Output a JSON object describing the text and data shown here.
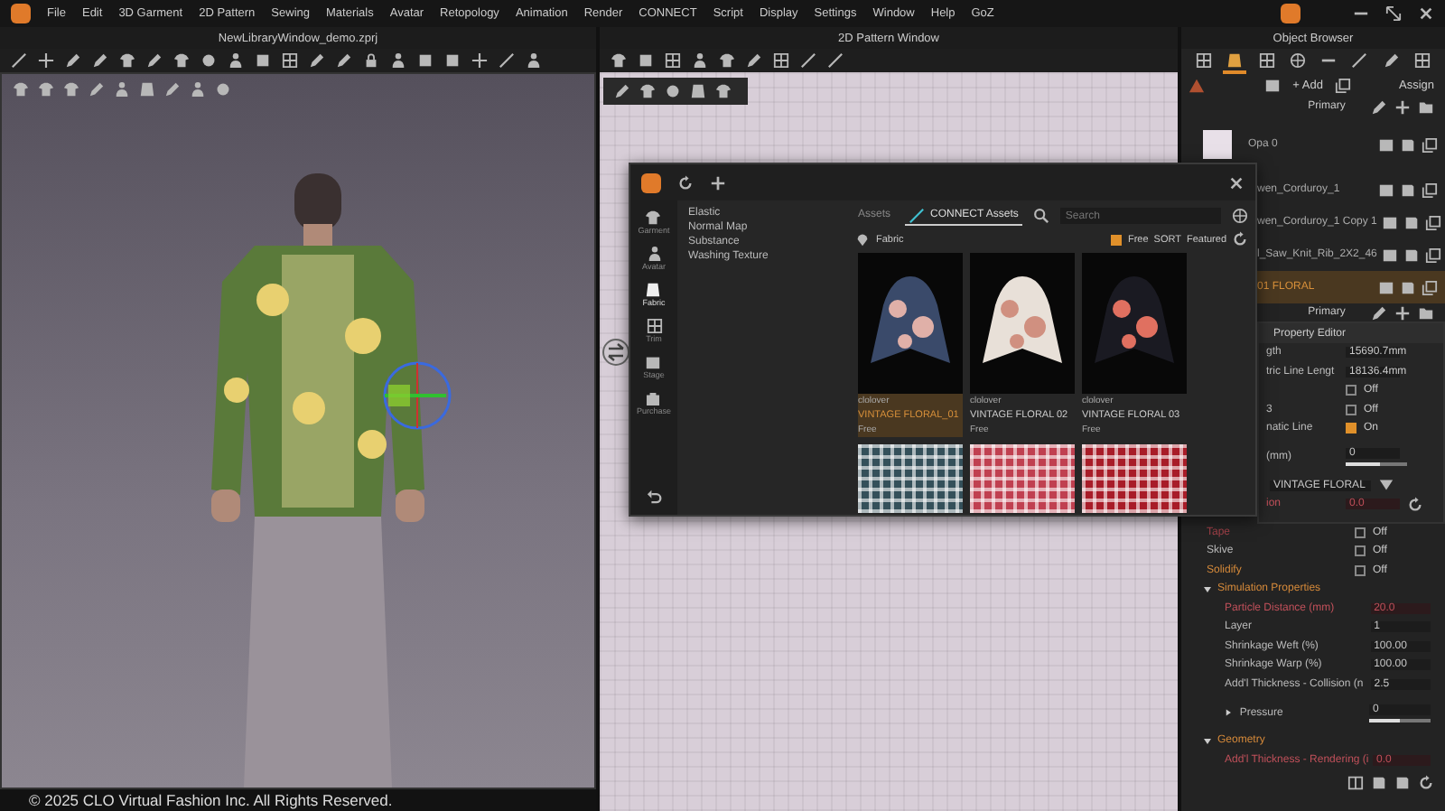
{
  "menu": {
    "items": [
      "File",
      "Edit",
      "3D Garment",
      "2D Pattern",
      "Sewing",
      "Materials",
      "Avatar",
      "Retopology",
      "Animation",
      "Render",
      "CONNECT",
      "Script",
      "Display",
      "Settings",
      "Window",
      "Help",
      "GoZ"
    ]
  },
  "viewport": {
    "title": "NewLibraryWindow_demo.zprj",
    "copyright": "© 2025 CLO Virtual Fashion Inc. All Rights Reserved."
  },
  "pattern_window": {
    "title": "2D Pattern Window"
  },
  "object_browser": {
    "title": "Object Browser",
    "tabs": [
      {
        "selected": false
      },
      {
        "selected": true
      },
      {
        "selected": false
      },
      {
        "selected": false
      },
      {
        "selected": false
      },
      {
        "selected": false
      },
      {
        "selected": false
      },
      {
        "selected": false
      }
    ],
    "add": "+ Add",
    "assign": "Assign",
    "group": "Primary",
    "items": [
      {
        "name": "Opa 0",
        "kind": "swatch",
        "selected": false
      },
      {
        "name": "wen_Corduroy_1",
        "kind": "plain",
        "selected": false
      },
      {
        "name": "wen_Corduroy_1 Copy 1",
        "kind": "plain",
        "selected": false
      },
      {
        "name": "l_Saw_Knit_Rib_2X2_46",
        "kind": "plain",
        "selected": false
      },
      {
        "name": "01 FLORAL",
        "kind": "plain",
        "selected": true
      }
    ],
    "group_2": "Primary"
  },
  "property_editor": {
    "title": "Property Editor",
    "rows": [
      {
        "kind": "value",
        "label": "gth",
        "value": "15690.7mm"
      },
      {
        "kind": "value",
        "label": "tric Line Lengt",
        "value": "18136.4mm"
      },
      {
        "kind": "toggle",
        "checked": false,
        "value": "Off"
      },
      {
        "kind": "toggle",
        "label": "3",
        "checked": false,
        "value": "Off"
      },
      {
        "kind": "toggle",
        "label": "natic Line",
        "checked": true,
        "value": "On"
      },
      {
        "kind": "slider",
        "label": "(mm)",
        "value": "0",
        "level": 0.55
      },
      {
        "kind": "dropdown",
        "value": "VINTAGE FLORAL"
      },
      {
        "kind": "spin",
        "label": "ion",
        "value": "0.0",
        "color": "#c0505a"
      }
    ],
    "lower_rows": [
      {
        "kind": "toggle",
        "label": "Tape",
        "checked": false,
        "value": "Off",
        "color": "#a04048"
      },
      {
        "kind": "toggle",
        "label": "Skive",
        "checked": false,
        "value": "Off"
      },
      {
        "kind": "toggle",
        "label": "Solidify",
        "checked": false,
        "value": "Off",
        "color": "#d68a3a"
      }
    ],
    "sections": [
      {
        "title": "Simulation Properties",
        "expanded": true,
        "rows": [
          {
            "kind": "value",
            "label": "Particle Distance (mm)",
            "value": "20.0",
            "color": "#c0505a"
          },
          {
            "kind": "value",
            "label": "Layer",
            "value": "1"
          },
          {
            "kind": "value",
            "label": "Shrinkage Weft (%)",
            "value": "100.00"
          },
          {
            "kind": "value",
            "label": "Shrinkage Warp (%)",
            "value": "100.00"
          },
          {
            "kind": "value",
            "label": "Add'l Thickness - Collision (n",
            "value": "2.5"
          },
          {
            "kind": "group_slider",
            "label": "Pressure",
            "expanded": false,
            "value": "0",
            "level": 0.5
          }
        ]
      },
      {
        "title": "Geometry",
        "expanded": true,
        "rows": [
          {
            "kind": "value",
            "label": "Add'l Thickness - Rendering (i",
            "value": "0.0",
            "color": "#c0505a"
          }
        ]
      }
    ]
  },
  "library": {
    "sidebar": [
      {
        "label": "Garment",
        "selected": false
      },
      {
        "label": "Avatar",
        "selected": false
      },
      {
        "label": "Fabric",
        "selected": true
      },
      {
        "label": "Trim",
        "selected": false
      },
      {
        "label": "Stage",
        "selected": false
      },
      {
        "label": "Purchase",
        "selected": false
      }
    ],
    "categories": [
      "Elastic",
      "Normal Map",
      "Substance",
      "Washing Texture"
    ],
    "tabs": [
      {
        "label": "Assets",
        "selected": false
      },
      {
        "label": "CONNECT Assets",
        "selected": true
      }
    ],
    "search": {
      "placeholder": "Search"
    },
    "breadcrumb": "Fabric",
    "filter": {
      "label": "Free",
      "checked": true
    },
    "sort_label": "SORT",
    "sort_value": "Featured",
    "assets": [
      {
        "kind": "floral",
        "author": "clolover",
        "name": "VINTAGE FLORAL_01",
        "price": "Free",
        "selected": true
      },
      {
        "kind": "floral",
        "author": "clolover",
        "name": "VINTAGE FLORAL 02",
        "price": "Free",
        "selected": false
      },
      {
        "kind": "floral",
        "author": "clolover",
        "name": "VINTAGE FLORAL 03",
        "price": "Free",
        "selected": false
      },
      {
        "kind": "plaid",
        "selected": false
      },
      {
        "kind": "plaid",
        "selected": false
      },
      {
        "kind": "plaid",
        "selected": false
      }
    ]
  }
}
